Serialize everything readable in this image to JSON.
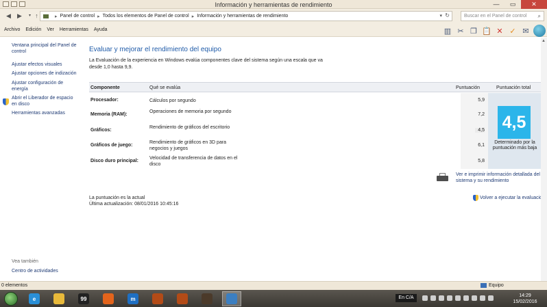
{
  "window": {
    "title": "Información y herramientas de rendimiento",
    "controls": {
      "minimize": "—",
      "maximize": "▭",
      "close": "✕"
    }
  },
  "address": {
    "breadcrumbs": [
      "Panel de control",
      "Todos los elementos de Panel de control",
      "Información y herramientas de rendimiento"
    ],
    "search_placeholder": "Buscar en el Panel de control"
  },
  "menu": [
    "Archivo",
    "Edición",
    "Ver",
    "Herramientas",
    "Ayuda"
  ],
  "toolbar_icons": [
    "layout-icon",
    "cut-icon",
    "copy-icon",
    "paste-icon",
    "delete-icon",
    "checkmark-icon",
    "email-icon",
    "globe-icon"
  ],
  "sidebar": {
    "links": [
      "Ventana principal del Panel de control",
      "Ajustar efectos visuales",
      "Ajustar opciones de indización",
      "Ajustar configuración de energía",
      "Abrir el Liberador de espacio en disco",
      "Herramientas avanzadas"
    ],
    "see_also_title": "Vea también",
    "see_also_link": "Centro de actividades"
  },
  "main": {
    "heading": "Evaluar y mejorar el rendimiento del equipo",
    "intro": "La Evaluación de la experiencia en Windows evalúa componentes clave del sistema según una escala que va desde 1,0 hasta 9,9.",
    "table": {
      "headers": {
        "component": "Componente",
        "what": "Qué se evalúa",
        "score": "Puntuación",
        "total": "Puntuación total"
      },
      "rows": [
        {
          "component": "Procesador:",
          "what": "Cálculos por segundo",
          "score": "5,9"
        },
        {
          "component": "Memoria (RAM):",
          "what": "Operaciones de memoria por segundo",
          "score": "7,2"
        },
        {
          "component": "Gráficos:",
          "what": "Rendimiento de gráficos del escritorio",
          "score": "4,5"
        },
        {
          "component": "Gráficos de juego:",
          "what": "Rendimiento de gráficos en 3D para negocios y juegos",
          "score": "6,1"
        },
        {
          "component": "Disco duro principal:",
          "what": "Velocidad de transferencia de datos en el disco",
          "score": "5,8"
        }
      ],
      "total_score": "4,5",
      "total_caption": "Determinado por la puntuación más baja"
    },
    "print_link": "Ver e imprimir información detallada del sistema y su rendimiento",
    "status_current": "La puntuación es la actual",
    "last_update": "Última actualización: 08/01/2016 10:45:16",
    "rerun_link": "Volver a ejecutar la evaluación"
  },
  "statusbar": {
    "items": "0 elementos",
    "location": "Equipo"
  },
  "taskbar": {
    "apps": [
      {
        "name": "ie-icon",
        "color": "#2a8fd6",
        "label": "e"
      },
      {
        "name": "file-explorer-icon",
        "color": "#e8b93a",
        "label": ""
      },
      {
        "name": "cmd-icon",
        "color": "#222222",
        "label": "99"
      },
      {
        "name": "firefox-icon",
        "color": "#e3641c",
        "label": ""
      },
      {
        "name": "maxthon-icon",
        "color": "#1f6fc2",
        "label": "m"
      },
      {
        "name": "app-orange-1-icon",
        "color": "#b34b17",
        "label": ""
      },
      {
        "name": "app-orange-2-icon",
        "color": "#b34b17",
        "label": ""
      },
      {
        "name": "game-icon",
        "color": "#4b3a2a",
        "label": ""
      },
      {
        "name": "control-panel-icon",
        "color": "#3c7fc1",
        "label": ""
      }
    ],
    "language": "En C/A",
    "time": "14:29",
    "date": "15/02/2016"
  }
}
